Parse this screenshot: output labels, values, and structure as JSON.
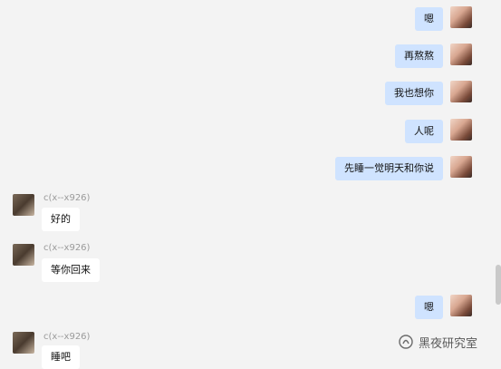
{
  "messages": [
    {
      "side": "me",
      "text": "嗯"
    },
    {
      "side": "me",
      "text": "再熬熬"
    },
    {
      "side": "me",
      "text": "我也想你"
    },
    {
      "side": "me",
      "text": "人呢"
    },
    {
      "side": "me",
      "text": "先睡一觉明天和你说"
    },
    {
      "side": "other",
      "sender": "c(x--x926)",
      "text": "好的"
    },
    {
      "side": "other",
      "sender": "c(x--x926)",
      "text": "等你回来"
    },
    {
      "side": "me",
      "text": "嗯"
    },
    {
      "side": "other",
      "sender": "c(x--x926)",
      "text": "睡吧"
    }
  ],
  "watermark": {
    "text": "黑夜研究室",
    "icon": "wechat-official-account-icon"
  }
}
